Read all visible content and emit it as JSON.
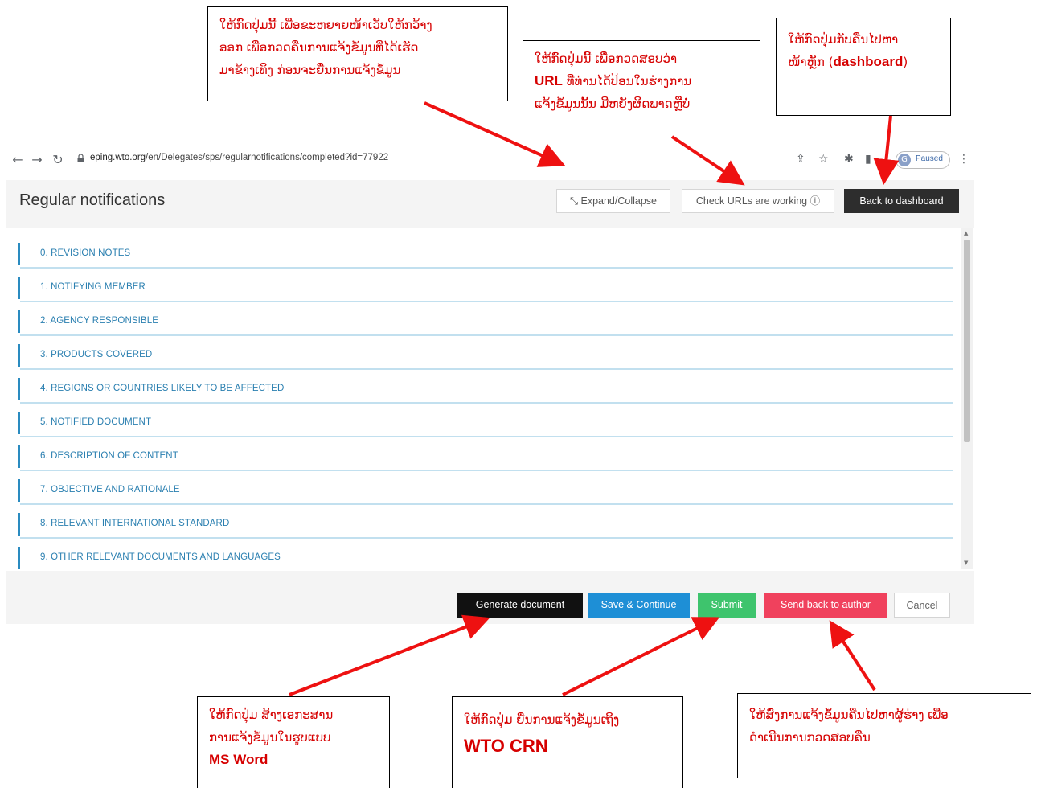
{
  "browser": {
    "url_host": "eping.wto.org",
    "url_path": "/en/Delegates/sps/regularnotifications/completed?id=77922",
    "profile_initial": "G",
    "profile_status": "Paused"
  },
  "header": {
    "title": "Regular notifications",
    "expand_label": "Expand/Collapse",
    "check_urls_label": "Check URLs are working",
    "back_label": "Back to dashboard"
  },
  "sections": [
    "0. REVISION NOTES",
    "1. NOTIFYING MEMBER",
    "2. AGENCY RESPONSIBLE",
    "3. PRODUCTS COVERED",
    "4. REGIONS OR COUNTRIES LIKELY TO BE AFFECTED",
    "5. NOTIFIED DOCUMENT",
    "6. DESCRIPTION OF CONTENT",
    "7. OBJECTIVE AND RATIONALE",
    "8. RELEVANT INTERNATIONAL STANDARD",
    "9. OTHER RELEVANT DOCUMENTS AND LANGUAGES"
  ],
  "footer": {
    "generate_label": "Generate document",
    "save_label": "Save & Continue",
    "submit_label": "Submit",
    "send_back_label": "Send back to author",
    "cancel_label": "Cancel"
  },
  "annotations": {
    "expand": [
      "ໃຫ້ກົດປຸ່ມນີ້ ເພື່ອຂະຫຍາຍໜ້າເວັບໃຫ້ກວ້າງ",
      "ອອກ ເພື່ອກວດຄືນການແຈ້ງຂໍ້ມູນທີ່ໄດ້ເຮັດ",
      "ມາຂ້າງເທິງ ກ່ອນຈະຍື່ນການແຈ້ງຂໍ້ມູນ"
    ],
    "check_urls": {
      "line1": "ໃຫ້ກົດປຸ່ມນີ້ ເພື່ອກວດສອບວ່າ",
      "bold": "URL",
      "line2_rest": " ທີ່ທ່ານໄດ້ປ້ອນໃນຮ່າງການ",
      "line3": "ແຈ້ງຂໍ້ມູນນັ້ນ ມີຫຍັງຜິດພາດຫຼືບໍ່"
    },
    "dashboard": {
      "line1": "ໃຫ້ກົດປຸ່ມກັບຄືນໄປຫາ",
      "line2_pre": "ໜ້າຫຼັກ (",
      "bold": "dashboard",
      "line2_post": ")"
    },
    "generate": {
      "line1": "ໃຫ້ກົດປຸ່ມ ສ້າງເອກະສານ",
      "line2": "ການແຈ້ງຂໍ້ມູນໃນຮູບແບບ",
      "bold": "MS Word"
    },
    "submit": {
      "line1": "ໃຫ້ກົດປຸ່ມ ຍື່ນການແຈ້ງຂໍ້ມູນເຖິງ",
      "bold": "WTO CRN"
    },
    "send_back": [
      "ໃຫ້ສົ່ງການແຈ້ງຂໍ້ມູນຄືນໄປຫາຜູ້ຮ່າງ ເພື່ອ",
      "ດຳເນີນການກວດສອບຄືນ"
    ]
  },
  "colors": {
    "generate": "#111111",
    "save": "#1e8fd6",
    "submit": "#3ec46d",
    "send_back": "#f0415d",
    "accent": "#2a8bc0",
    "annotation": "#d60000"
  }
}
